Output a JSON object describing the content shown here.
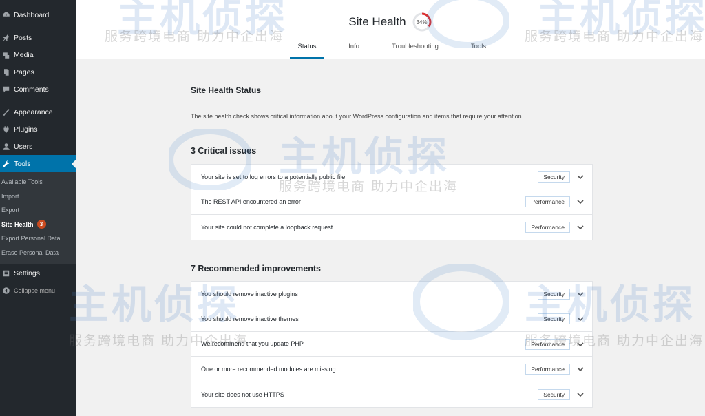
{
  "sidebar": {
    "items": [
      {
        "label": "Dashboard",
        "icon": "dashboard-icon"
      },
      {
        "label": "Posts",
        "icon": "pin-icon"
      },
      {
        "label": "Media",
        "icon": "media-icon"
      },
      {
        "label": "Pages",
        "icon": "pages-icon"
      },
      {
        "label": "Comments",
        "icon": "comments-icon"
      },
      {
        "label": "Appearance",
        "icon": "brush-icon"
      },
      {
        "label": "Plugins",
        "icon": "plugin-icon"
      },
      {
        "label": "Users",
        "icon": "users-icon"
      },
      {
        "label": "Tools",
        "icon": "wrench-icon"
      }
    ],
    "tools_submenu": [
      {
        "label": "Available Tools"
      },
      {
        "label": "Import"
      },
      {
        "label": "Export"
      },
      {
        "label": "Site Health",
        "badge": "3"
      },
      {
        "label": "Export Personal Data"
      },
      {
        "label": "Erase Personal Data"
      }
    ],
    "settings": {
      "label": "Settings",
      "icon": "settings-icon"
    },
    "collapse": {
      "label": "Collapse menu",
      "icon": "collapse-icon"
    }
  },
  "header": {
    "title": "Site Health",
    "score": "34%",
    "score_value": 0.34,
    "tabs": [
      {
        "label": "Status",
        "active": true
      },
      {
        "label": "Info"
      },
      {
        "label": "Troubleshooting"
      },
      {
        "label": "Tools"
      }
    ]
  },
  "main": {
    "section_title": "Site Health Status",
    "description": "The site health check shows critical information about your WordPress configuration and items that require your attention.",
    "critical": {
      "title": "3 Critical issues",
      "items": [
        {
          "text": "Your site is set to log errors to a potentially public file.",
          "tag": "Security"
        },
        {
          "text": "The REST API encountered an error",
          "tag": "Performance"
        },
        {
          "text": "Your site could not complete a loopback request",
          "tag": "Performance"
        }
      ]
    },
    "recommended": {
      "title": "7 Recommended improvements",
      "items": [
        {
          "text": "You should remove inactive plugins",
          "tag": "Security"
        },
        {
          "text": "You should remove inactive themes",
          "tag": "Security"
        },
        {
          "text": "We recommend that you update PHP",
          "tag": "Performance"
        },
        {
          "text": "One or more recommended modules are missing",
          "tag": "Performance"
        },
        {
          "text": "Your site does not use HTTPS",
          "tag": "Security"
        }
      ]
    }
  },
  "watermark": {
    "big": "主机侦探",
    "small": "服务跨境电商 助力中企出海"
  },
  "colors": {
    "sidebar_bg": "#23282d",
    "accent": "#0073aa",
    "badge": "#ca4a1f",
    "progress": "#dc3232"
  }
}
